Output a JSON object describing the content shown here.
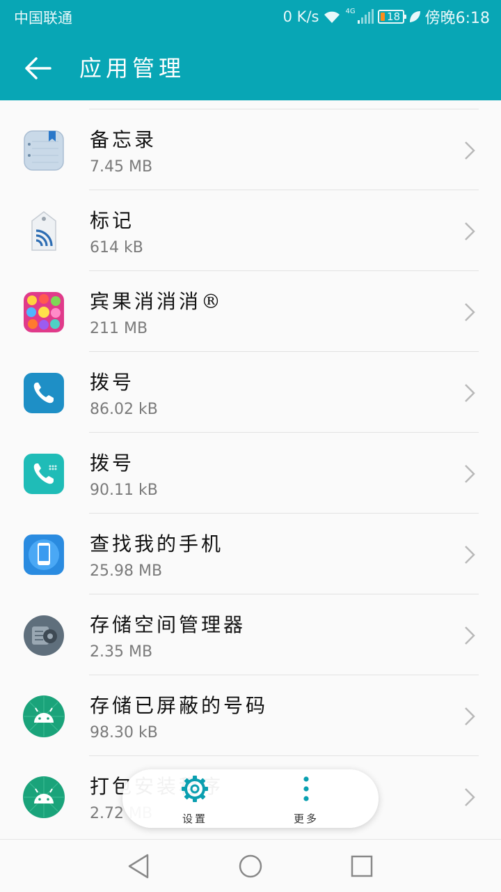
{
  "status_bar": {
    "carrier": "中国联通",
    "speed": "0 K/s",
    "network": "4G",
    "battery": "18",
    "time": "傍晚6:18"
  },
  "header": {
    "title": "应用管理",
    "back_icon": "arrow-left-icon"
  },
  "apps": [
    {
      "name": "备忘录",
      "size": "7.45 MB",
      "icon": "notepad-icon"
    },
    {
      "name": "标记",
      "size": "614 kB",
      "icon": "nfc-tag-icon"
    },
    {
      "name": "宾果消消消®",
      "size": "211 MB",
      "icon": "candy-game-icon"
    },
    {
      "name": "拨号",
      "size": "86.02 kB",
      "icon": "phone-icon"
    },
    {
      "name": "拨号",
      "size": "90.11 kB",
      "icon": "phone-icon"
    },
    {
      "name": "查找我的手机",
      "size": "25.98 MB",
      "icon": "find-phone-icon"
    },
    {
      "name": "存储空间管理器",
      "size": "2.35 MB",
      "icon": "storage-gear-icon"
    },
    {
      "name": "存储已屏蔽的号码",
      "size": "98.30 kB",
      "icon": "android-icon"
    },
    {
      "name": "打包安装程序",
      "size": "2.72 MB",
      "icon": "android-icon"
    }
  ],
  "actions": {
    "settings_label": "设置",
    "more_label": "更多"
  },
  "colors": {
    "header": "#08a6b5",
    "accent": "#0a9fb0",
    "android_green": "#1aa37a"
  }
}
